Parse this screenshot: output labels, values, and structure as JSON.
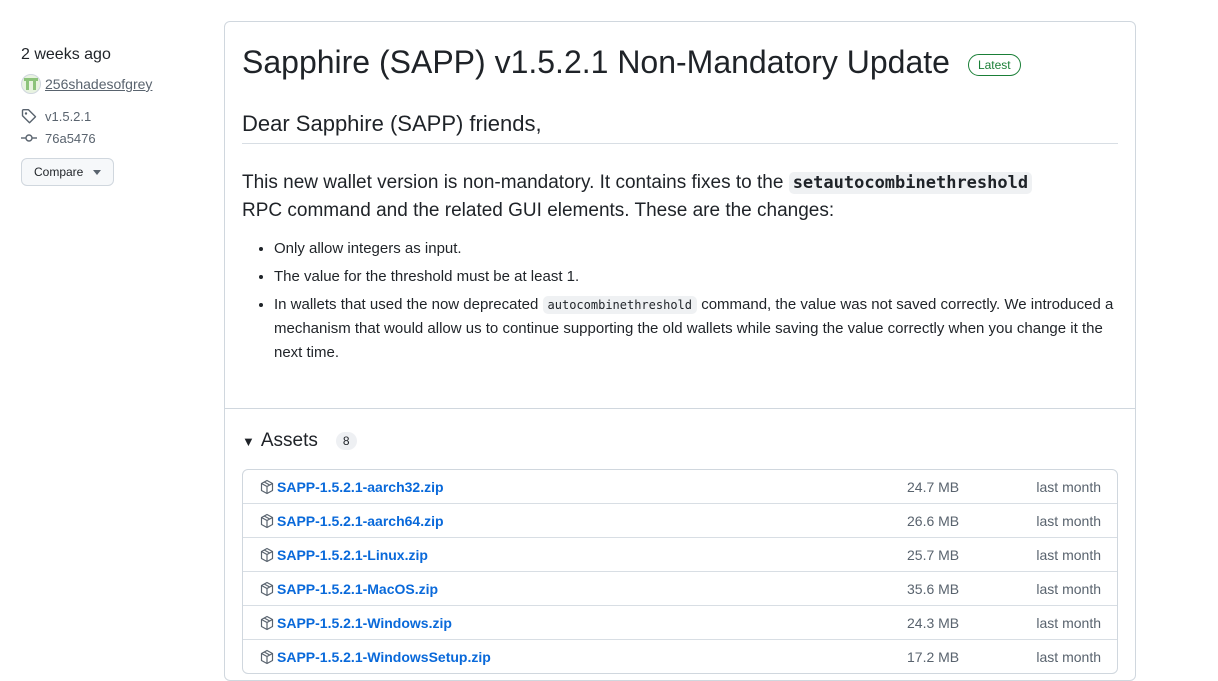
{
  "sidebar": {
    "date": "2 weeks ago",
    "author": "256shadesofgrey",
    "tag": "v1.5.2.1",
    "commit": "76a5476",
    "compare_label": "Compare"
  },
  "release": {
    "title": "Sapphire (SAPP) v1.5.2.1 Non-Mandatory Update",
    "badge": "Latest",
    "greeting": "Dear Sapphire (SAPP) friends,",
    "intro_before": "This new wallet version is non-mandatory. It contains fixes to the",
    "intro_code": "setautocombinethreshold",
    "intro_after": "RPC command and the related GUI elements. These are the changes:",
    "changes": [
      "Only allow integers as input.",
      "The value for the threshold must be at least 1."
    ],
    "change3_before": "In wallets that used the now deprecated",
    "change3_code": "autocombinethreshold",
    "change3_after": "command, the value was not saved correctly. We introduced a mechanism that would allow us to continue supporting the old wallets while saving the value correctly when you change it the next time."
  },
  "assets": {
    "heading": "Assets",
    "count": "8",
    "items": [
      {
        "name": "SAPP-1.5.2.1-aarch32.zip",
        "size": "24.7 MB",
        "date": "last month"
      },
      {
        "name": "SAPP-1.5.2.1-aarch64.zip",
        "size": "26.6 MB",
        "date": "last month"
      },
      {
        "name": "SAPP-1.5.2.1-Linux.zip",
        "size": "25.7 MB",
        "date": "last month"
      },
      {
        "name": "SAPP-1.5.2.1-MacOS.zip",
        "size": "35.6 MB",
        "date": "last month"
      },
      {
        "name": "SAPP-1.5.2.1-Windows.zip",
        "size": "24.3 MB",
        "date": "last month"
      },
      {
        "name": "SAPP-1.5.2.1-WindowsSetup.zip",
        "size": "17.2 MB",
        "date": "last month"
      }
    ]
  },
  "colors": {
    "link": "#0969da",
    "latest": "#1a7f37",
    "muted": "#59636e",
    "border": "#d0d7de"
  }
}
